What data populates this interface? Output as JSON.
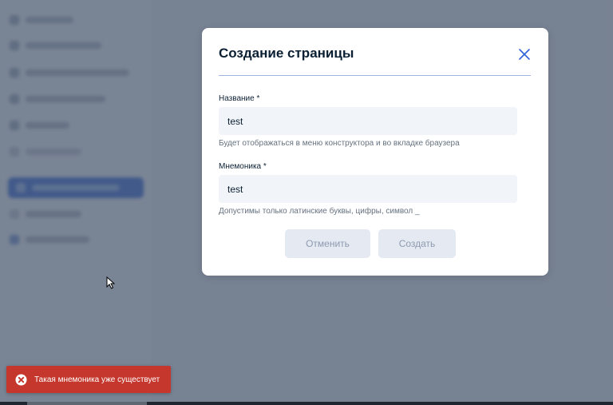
{
  "modal": {
    "title": "Создание страницы",
    "name_field": {
      "label": "Название *",
      "value": "test",
      "hint": "Будет отображаться в меню конструктора и во вкладке браузера"
    },
    "mnemonic_field": {
      "label": "Мнемоника *",
      "value": "test",
      "hint": "Допустимы только латинские буквы, цифры, символ _"
    },
    "cancel_label": "Отменить",
    "create_label": "Создать"
  },
  "toast": {
    "message": "Такая мнемоника уже существует",
    "icon": "error-circle-x-icon",
    "color": "#c5372d"
  },
  "colors": {
    "overlay": "#4a576c",
    "accent": "#2f62d8",
    "title_text": "#0b1f33",
    "disabled_button_bg": "#e4e9f2"
  }
}
